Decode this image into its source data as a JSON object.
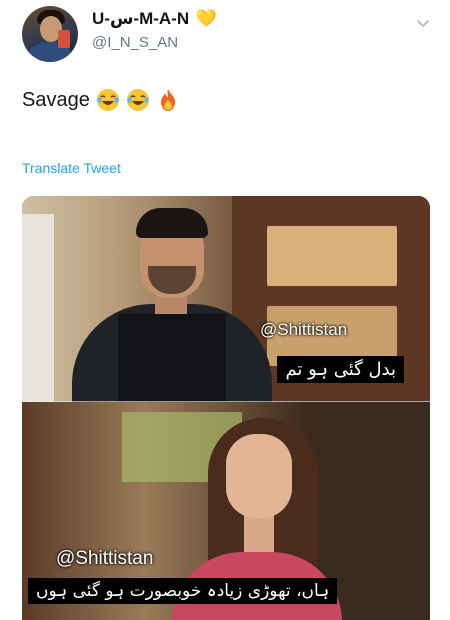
{
  "tweet": {
    "display_name": "U-س-M-A-N",
    "name_emoji": "💛",
    "handle": "@I_N_S_AN",
    "text": "Savage",
    "emojis": [
      "laughing-tears",
      "laughing-tears",
      "fire"
    ],
    "translate_label": "Translate Tweet"
  },
  "media": {
    "top_panel": {
      "watermark": "@Shittistan",
      "subtitle": "بدل گئی ہو تم"
    },
    "bottom_panel": {
      "watermark": "@Shittistan",
      "subtitle": "ہاں، تھوڑی زیادہ خوبصورت ہو گئی ہوں"
    }
  },
  "icons": {
    "menu": "chevron-down-icon",
    "heart": "yellow-heart-icon"
  },
  "colors": {
    "link": "#1da1f2",
    "handle": "#657786",
    "heart": "#f5c518"
  }
}
